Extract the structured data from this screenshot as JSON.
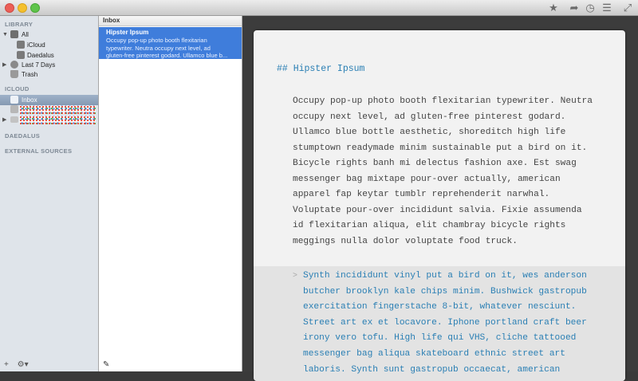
{
  "sidebar": {
    "sections": {
      "library": "LIBRARY",
      "icloud": "ICLOUD",
      "daedalus": "DAEDALUS",
      "external": "EXTERNAL SOURCES"
    },
    "items": {
      "all": "All",
      "icloud": "iCloud",
      "daedalus": "Daedalus",
      "last7": "Last 7 Days",
      "trash": "Trash",
      "inbox": "Inbox"
    },
    "bottom": {
      "add": "+",
      "gear": "⚙▾"
    }
  },
  "list": {
    "header": "Inbox",
    "note_title": "Hipster Ipsum",
    "note_preview": [
      "Occupy pop-up photo booth flexitarian",
      "typewriter. Neutra occupy next level, ad",
      "gluten-free pinterest godard. Ullamco blue b..."
    ],
    "new_note_icon": "✎"
  },
  "toolbar": {
    "star": "★",
    "share": "➦",
    "clock": "◷",
    "list": "☰",
    "fullscreen": "⤢"
  },
  "editor": {
    "heading": "## Hipster Ipsum",
    "paragraph": "Occupy pop-up photo booth flexitarian typewriter. Neutra\noccupy next level, ad gluten-free pinterest godard.\nUllamco blue bottle aesthetic, shoreditch high life\nstumptown readymade minim sustainable put a bird on it.\nBicycle rights banh mi delectus fashion axe. Est swag\nmessenger bag mixtape pour-over actually, american\napparel fap keytar tumblr reprehenderit narwhal.\nVoluptate pour-over incididunt salvia. Fixie assumenda\nid flexitarian aliqua, elit chambray bicycle rights\nmeggings nulla dolor voluptate food truck.",
    "quote_marker": ">",
    "quote": "Synth incididunt vinyl put a bird on it, wes anderson\nbutcher brooklyn kale chips minim. Bushwick gastropub\nexercitation fingerstache 8-bit, whatever nesciunt.\nStreet art ex et locavore. Iphone portland craft beer\nirony vero tofu. High life qui VHS, cliche tattooed\nmessenger bag aliqua skateboard ethnic street art\nlaboris. Synth sunt gastropub occaecat, american"
  }
}
